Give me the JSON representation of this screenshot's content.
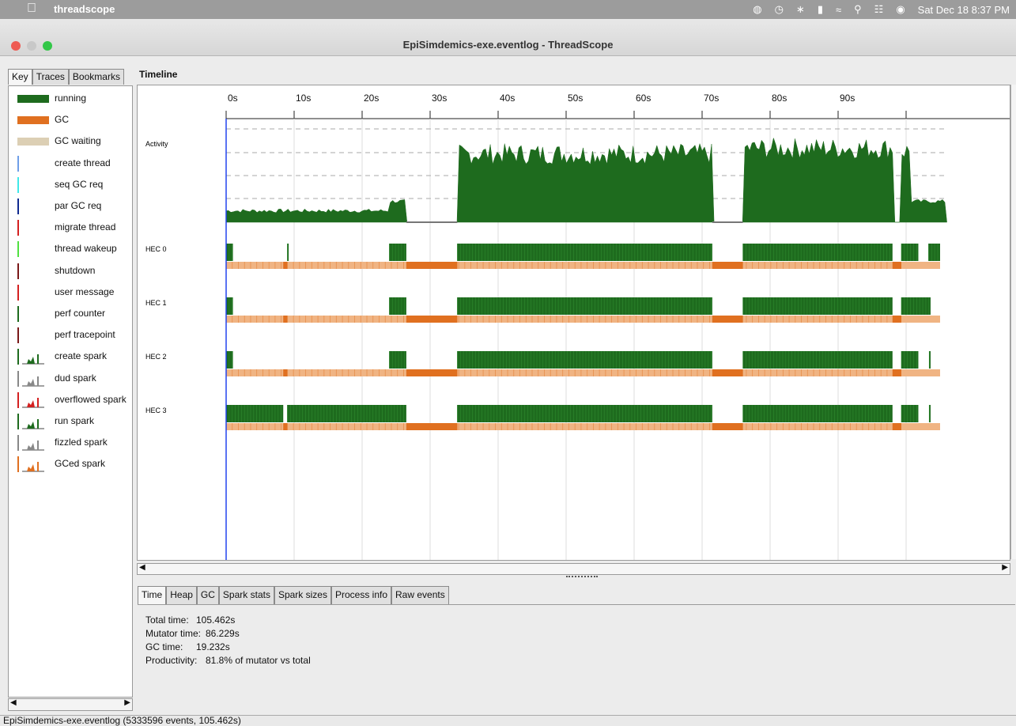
{
  "menubar": {
    "app_name": "threadscope",
    "clock": "Sat Dec 18  8:37 PM"
  },
  "window": {
    "title": "EpiSimdemics-exe.eventlog - ThreadScope"
  },
  "left_tabs": [
    "Key",
    "Traces",
    "Bookmarks"
  ],
  "key_items": [
    {
      "label": "running",
      "kind": "bar",
      "color": "#1e6b1e"
    },
    {
      "label": "GC",
      "kind": "bar",
      "color": "#e07020"
    },
    {
      "label": "GC waiting",
      "kind": "bar",
      "color": "#dccfb4"
    },
    {
      "label": "create thread",
      "kind": "line",
      "color": "#6f9ee8"
    },
    {
      "label": "seq GC req",
      "kind": "line",
      "color": "#40e8e8"
    },
    {
      "label": "par GC req",
      "kind": "line",
      "color": "#102a90"
    },
    {
      "label": "migrate thread",
      "kind": "line",
      "color": "#d42020"
    },
    {
      "label": "thread wakeup",
      "kind": "line",
      "color": "#50e040"
    },
    {
      "label": "shutdown",
      "kind": "line",
      "color": "#7a1818"
    },
    {
      "label": "user message",
      "kind": "line",
      "color": "#d42020"
    },
    {
      "label": "perf counter",
      "kind": "line",
      "color": "#1e6b1e"
    },
    {
      "label": "perf tracepoint",
      "kind": "line",
      "color": "#7a1818"
    },
    {
      "label": "create spark",
      "kind": "spark",
      "color": "#1e6b1e"
    },
    {
      "label": "dud spark",
      "kind": "spark",
      "color": "#888888"
    },
    {
      "label": "overflowed spark",
      "kind": "spark",
      "color": "#d42020"
    },
    {
      "label": "run spark",
      "kind": "spark",
      "color": "#1e6b1e"
    },
    {
      "label": "fizzled spark",
      "kind": "spark",
      "color": "#888888"
    },
    {
      "label": "GCed spark",
      "kind": "spark",
      "color": "#e07020"
    }
  ],
  "timeline": {
    "label": "Timeline",
    "ticks": [
      "0s",
      "10s",
      "20s",
      "30s",
      "40s",
      "50s",
      "60s",
      "70s",
      "80s",
      "90s"
    ],
    "activity_label": "Activity",
    "hecs": [
      "HEC 0",
      "HEC 1",
      "HEC 2",
      "HEC 3"
    ],
    "colors": {
      "running": "#1e6b1e",
      "gc": "#e07020",
      "gc_light": "#f0b483",
      "cursor": "#2244ee"
    }
  },
  "bottom_tabs": [
    "Time",
    "Heap",
    "GC",
    "Spark stats",
    "Spark sizes",
    "Process info",
    "Raw events"
  ],
  "info": [
    {
      "key": "Total time:",
      "value": "105.462s"
    },
    {
      "key": "Mutator time:",
      "value": "86.229s"
    },
    {
      "key": "GC time:",
      "value": "19.232s"
    },
    {
      "key": "Productivity:",
      "value": "81.8% of mutator vs total"
    }
  ],
  "status": "EpiSimdemics-exe.eventlog (5333596 events, 105.462s)"
}
